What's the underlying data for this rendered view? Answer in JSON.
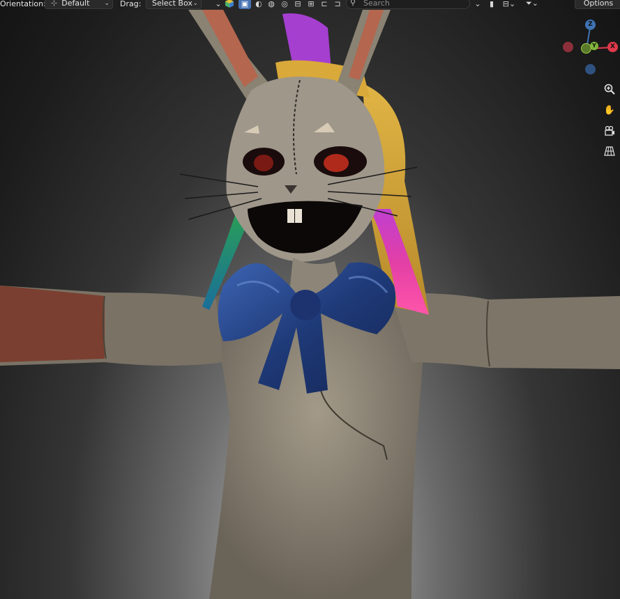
{
  "header": {
    "orientation_label": "Orientation:",
    "orientation_value": "Default",
    "drag_label": "Drag:",
    "drag_value": "Select Box",
    "search_placeholder": "Search",
    "options_label": "Options"
  },
  "gizmo": {
    "z_label": "Z",
    "x_label": "X",
    "y_label": "Y",
    "colors": {
      "x": "#e0394b",
      "y": "#80b33a",
      "z": "#3f73b4"
    }
  },
  "nav_icons": [
    "zoom-icon",
    "hand-pan-icon",
    "camera-icon",
    "perspective-grid-icon"
  ],
  "header_icons": [
    "viewport-shading-solid-icon",
    "matcap-sphere-icon",
    "material-preview-icon",
    "render-preview-icon",
    "overlay-icon",
    "gizmo-icon",
    "bookmark-icon",
    "editor-layout-icon",
    "filter-icon"
  ]
}
